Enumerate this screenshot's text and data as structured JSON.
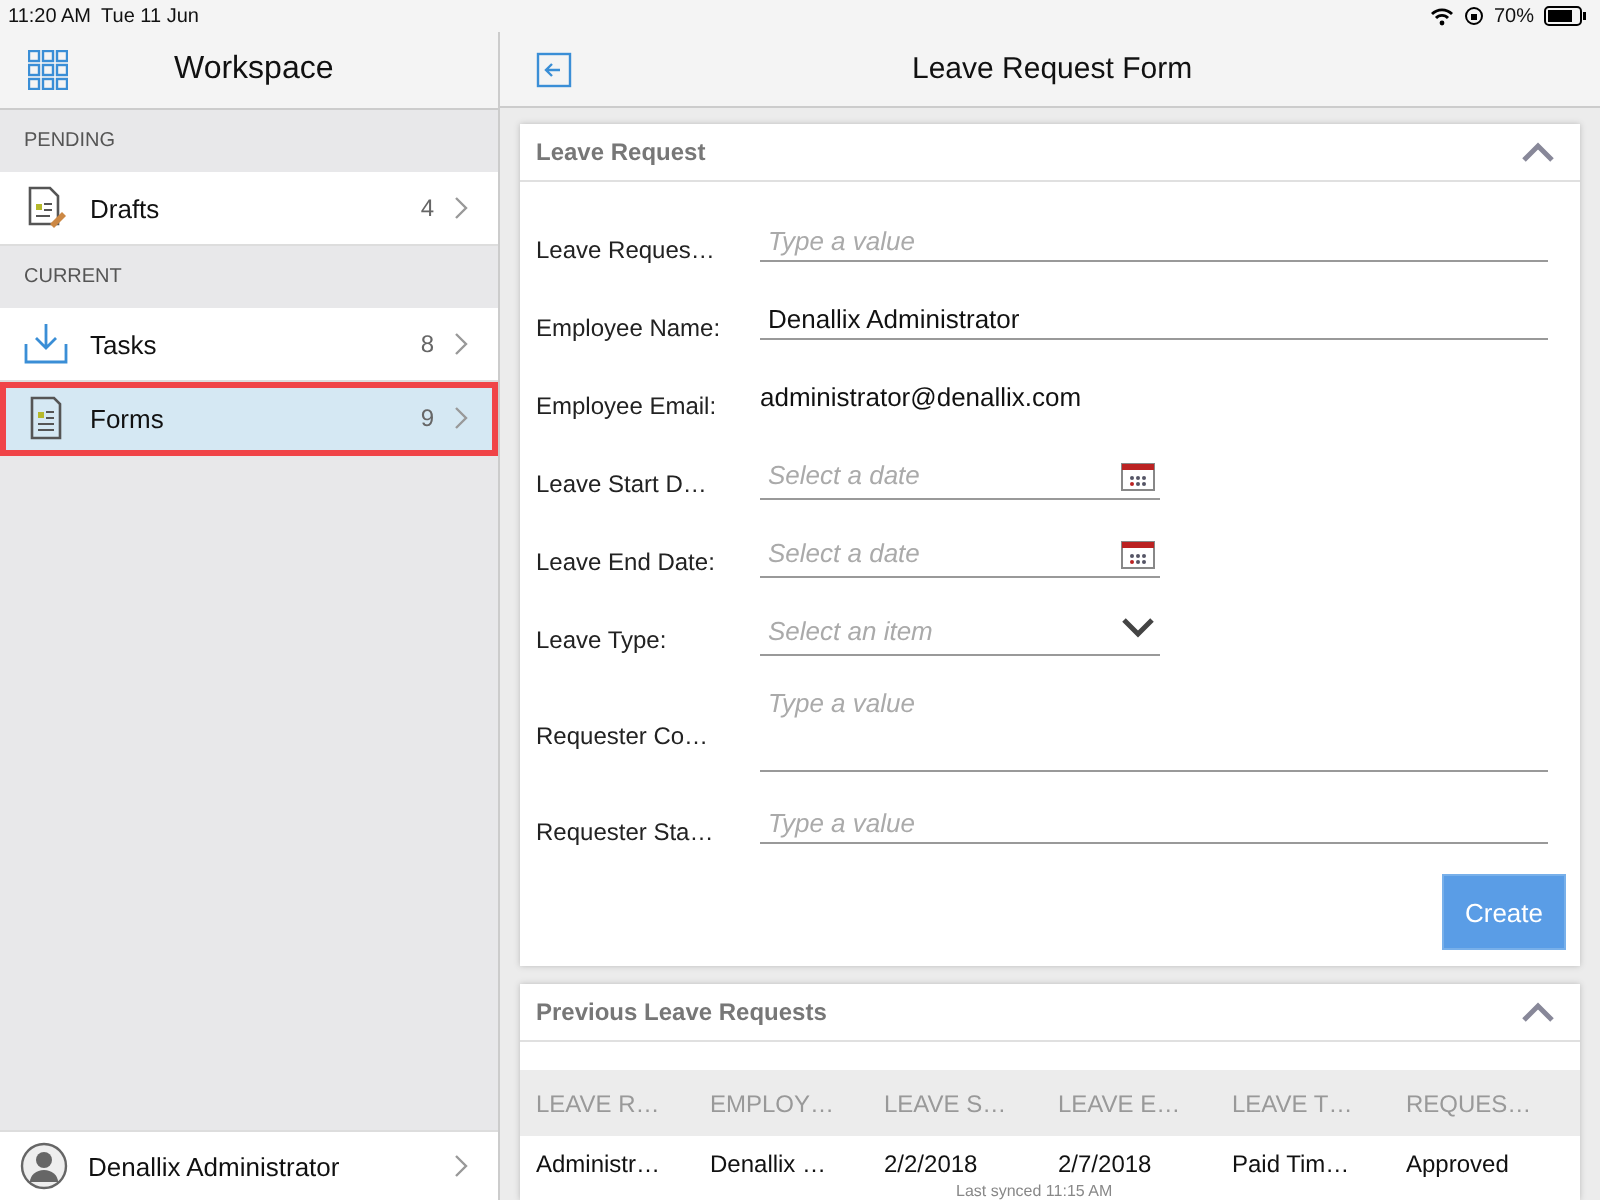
{
  "status_bar": {
    "time": "11:20 AM",
    "date": "Tue 11 Jun",
    "battery": "70%"
  },
  "sidebar": {
    "title": "Workspace",
    "sections": [
      {
        "heading": "PENDING",
        "items": [
          {
            "label": "Drafts",
            "count": "4",
            "kind": "drafts",
            "selected": false
          }
        ]
      },
      {
        "heading": "CURRENT",
        "items": [
          {
            "label": "Tasks",
            "count": "8",
            "kind": "tasks",
            "selected": false
          },
          {
            "label": "Forms",
            "count": "9",
            "kind": "forms",
            "selected": true
          }
        ]
      }
    ],
    "user": "Denallix Administrator"
  },
  "main": {
    "title": "Leave Request Form",
    "form": {
      "title": "Leave Request",
      "expanded": true,
      "fields": [
        {
          "label": "Leave Reques…",
          "kind": "text",
          "placeholder": "Type a value"
        },
        {
          "label": "Employee Name:",
          "kind": "text",
          "value": "Denallix Administrator"
        },
        {
          "label": "Employee Email:",
          "kind": "readonly",
          "value": "administrator@denallix.com"
        },
        {
          "label": "Leave Start D…",
          "kind": "date",
          "placeholder": "Select a date"
        },
        {
          "label": "Leave End Date:",
          "kind": "date",
          "placeholder": "Select a date"
        },
        {
          "label": "Leave Type:",
          "kind": "select",
          "placeholder": "Select an item"
        },
        {
          "label": "Requester Co…",
          "kind": "textarea",
          "placeholder": "Type a value"
        },
        {
          "label": "Requester Sta…",
          "kind": "text",
          "placeholder": "Type a value"
        }
      ],
      "button": "Create"
    },
    "table": {
      "title": "Previous Leave Requests",
      "expanded": true,
      "columns": [
        "LEAVE R…",
        "EMPLOY…",
        "LEAVE S…",
        "LEAVE E…",
        "LEAVE T…",
        "REQUES…"
      ],
      "rows": [
        [
          "Administr…",
          "Denallix …",
          "2/2/2018",
          "2/7/2018",
          "Paid Tim…",
          "Approved"
        ]
      ]
    },
    "sync_note": "Last synced 11:15 AM"
  }
}
